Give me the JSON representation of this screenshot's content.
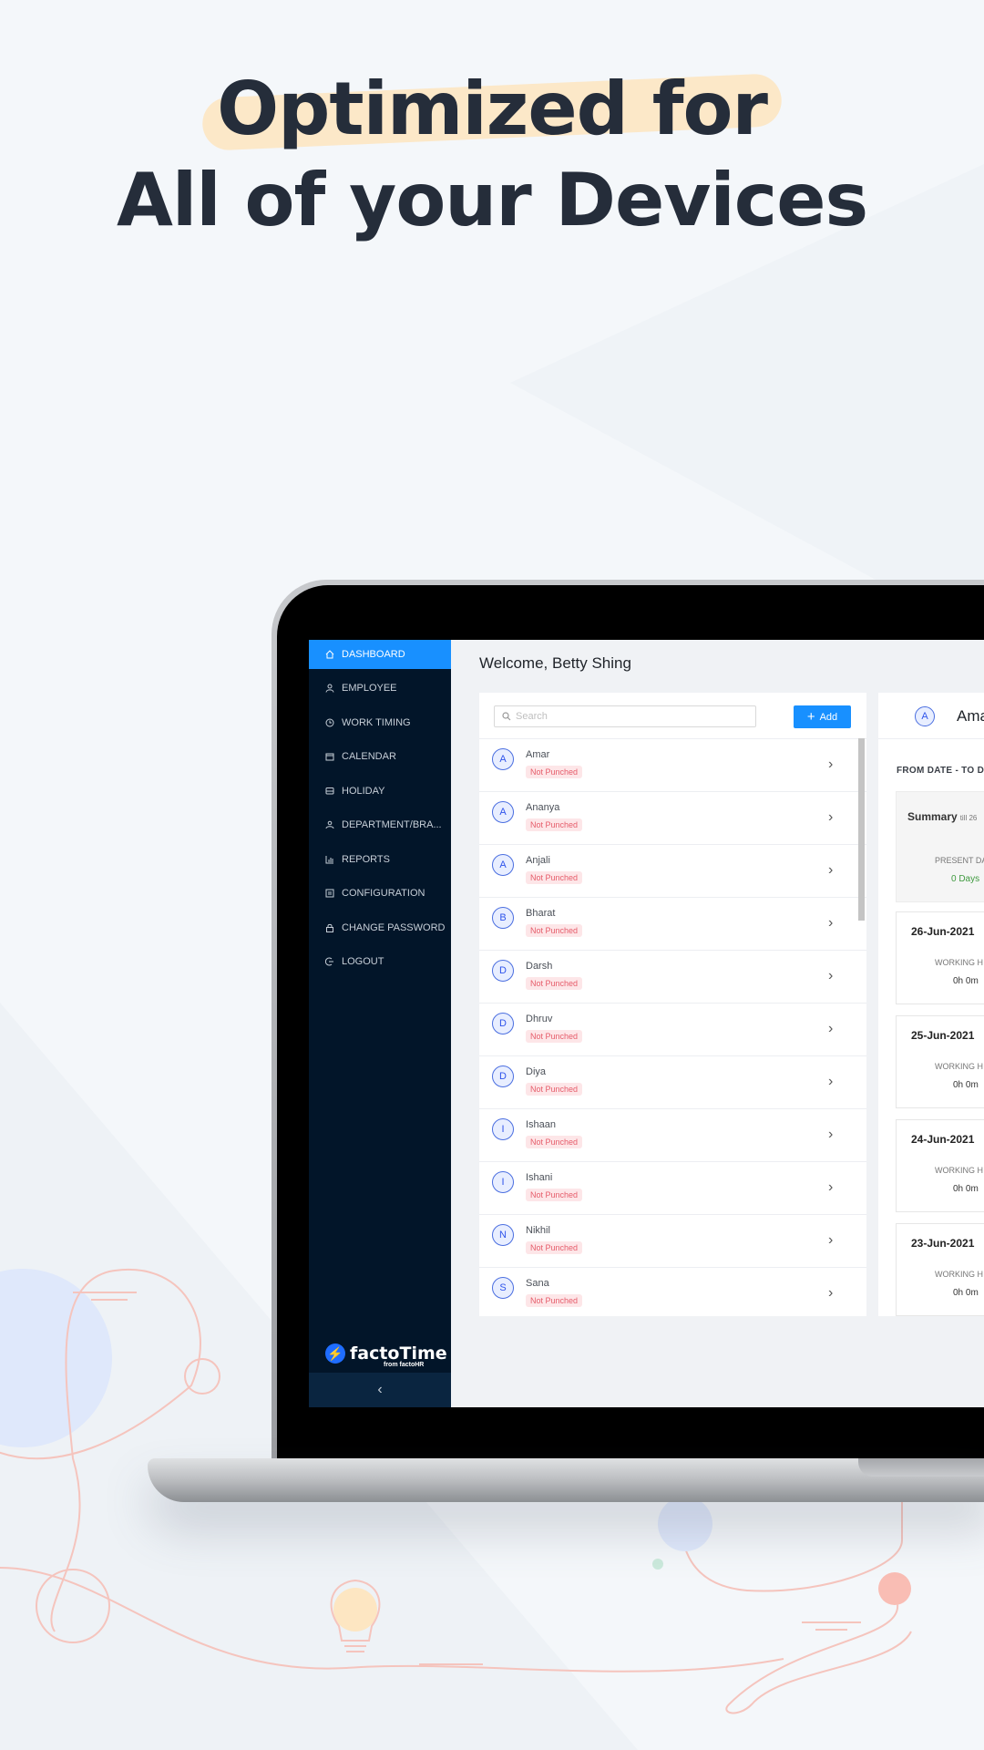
{
  "headline": {
    "line1": "Optimized for",
    "line2": "All of your Devices"
  },
  "sidebar": {
    "items": [
      {
        "label": "DASHBOARD",
        "icon": "home-icon",
        "active": true
      },
      {
        "label": "EMPLOYEE",
        "icon": "user-icon"
      },
      {
        "label": "WORK TIMING",
        "icon": "clock-icon"
      },
      {
        "label": "CALENDAR",
        "icon": "calendar-icon"
      },
      {
        "label": "HOLIDAY",
        "icon": "bus-icon"
      },
      {
        "label": "DEPARTMENT/BRA...",
        "icon": "team-icon"
      },
      {
        "label": "REPORTS",
        "icon": "bar-chart-icon"
      },
      {
        "label": "CONFIGURATION",
        "icon": "settings-icon"
      },
      {
        "label": "CHANGE PASSWORD",
        "icon": "lock-icon"
      },
      {
        "label": "LOGOUT",
        "icon": "logout-icon"
      }
    ],
    "brand": {
      "logo_glyph": "⚡",
      "name": "factoTime",
      "sub": "from factoHR"
    },
    "collapse_glyph": "‹"
  },
  "main": {
    "welcome": "Welcome, Betty Shing",
    "search_placeholder": "Search",
    "add_label": "Add",
    "employees": [
      {
        "initial": "A",
        "name": "Amar",
        "status": "Not Punched"
      },
      {
        "initial": "A",
        "name": "Ananya",
        "status": "Not Punched"
      },
      {
        "initial": "A",
        "name": "Anjali",
        "status": "Not Punched"
      },
      {
        "initial": "B",
        "name": "Bharat",
        "status": "Not Punched"
      },
      {
        "initial": "D",
        "name": "Darsh",
        "status": "Not Punched"
      },
      {
        "initial": "D",
        "name": "Dhruv",
        "status": "Not Punched"
      },
      {
        "initial": "D",
        "name": "Diya",
        "status": "Not Punched"
      },
      {
        "initial": "I",
        "name": "Ishaan",
        "status": "Not Punched"
      },
      {
        "initial": "I",
        "name": "Ishani",
        "status": "Not Punched"
      },
      {
        "initial": "N",
        "name": "Nikhil",
        "status": "Not Punched"
      },
      {
        "initial": "S",
        "name": "Sana",
        "status": "Not Punched"
      }
    ]
  },
  "detail": {
    "avatar_initial": "A",
    "name": "Ama",
    "range_label": "FROM DATE - TO D",
    "summary_title": "Summary",
    "summary_till": "till 26",
    "present_label": "PRESENT DA",
    "present_value": "0 Days",
    "days": [
      {
        "date": "26-Jun-2021",
        "label": "WORKING H",
        "value": "0h 0m"
      },
      {
        "date": "25-Jun-2021",
        "label": "WORKING H",
        "value": "0h 0m"
      },
      {
        "date": "24-Jun-2021",
        "label": "WORKING H",
        "value": "0h 0m"
      },
      {
        "date": "23-Jun-2021",
        "label": "WORKING H",
        "value": "0h 0m"
      }
    ]
  },
  "colors": {
    "accent": "#1890ff",
    "sidebar_bg": "#021529",
    "status_text": "#e65c6a",
    "status_bg": "#fde6e8",
    "present": "#3f9a3f",
    "highlight": "#fde6c2"
  }
}
